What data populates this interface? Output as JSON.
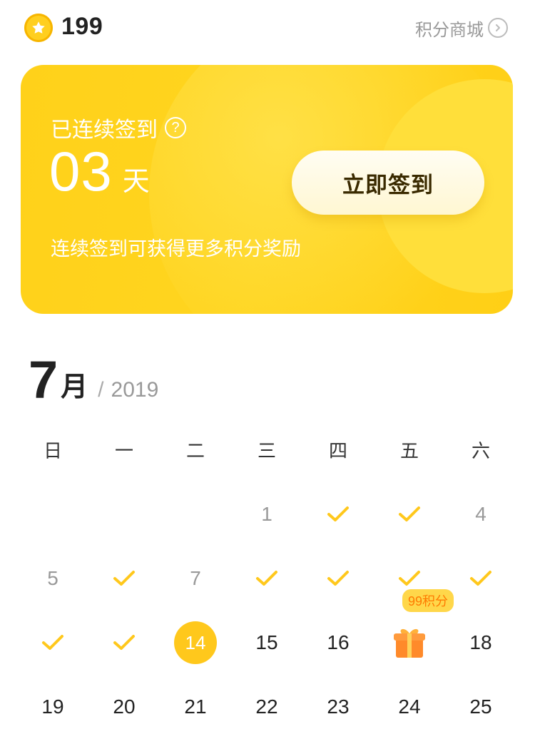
{
  "header": {
    "points_value": "199",
    "mall_label": "积分商城"
  },
  "card": {
    "label": "已连续签到",
    "streak_number": "03",
    "streak_unit": "天",
    "hint": "连续签到可获得更多积分奖励",
    "button_label": "立即签到"
  },
  "calendar": {
    "month_number": "7",
    "month_unit": "月",
    "slash": "/",
    "year": "2019",
    "weekdays": [
      "日",
      "一",
      "二",
      "三",
      "四",
      "五",
      "六"
    ],
    "days": [
      {
        "label": "",
        "state": "empty"
      },
      {
        "label": "",
        "state": "empty"
      },
      {
        "label": "",
        "state": "empty"
      },
      {
        "label": "1",
        "state": "muted"
      },
      {
        "label": "",
        "state": "checked"
      },
      {
        "label": "",
        "state": "checked"
      },
      {
        "label": "4",
        "state": "muted"
      },
      {
        "label": "5",
        "state": "muted"
      },
      {
        "label": "",
        "state": "checked"
      },
      {
        "label": "7",
        "state": "muted"
      },
      {
        "label": "",
        "state": "checked"
      },
      {
        "label": "",
        "state": "checked"
      },
      {
        "label": "",
        "state": "checked"
      },
      {
        "label": "",
        "state": "checked"
      },
      {
        "label": "",
        "state": "checked"
      },
      {
        "label": "",
        "state": "checked"
      },
      {
        "label": "14",
        "state": "today"
      },
      {
        "label": "15",
        "state": "normal"
      },
      {
        "label": "16",
        "state": "normal"
      },
      {
        "label": "",
        "state": "gift",
        "badge": "99积分"
      },
      {
        "label": "18",
        "state": "normal"
      },
      {
        "label": "19",
        "state": "normal"
      },
      {
        "label": "20",
        "state": "normal"
      },
      {
        "label": "21",
        "state": "normal"
      },
      {
        "label": "22",
        "state": "normal"
      },
      {
        "label": "23",
        "state": "normal"
      },
      {
        "label": "24",
        "state": "normal"
      },
      {
        "label": "25",
        "state": "normal"
      }
    ]
  },
  "colors": {
    "accent": "#ffc81c",
    "card_yellow": "#ffd51f",
    "check": "#ffc81c",
    "gift_orange": "#ff8a2a"
  },
  "icons": {
    "coin": "star-coin-icon",
    "mall_chevron": "chevron-right-circle-icon",
    "help": "question-circle-icon",
    "check": "check-icon",
    "gift": "gift-icon"
  }
}
